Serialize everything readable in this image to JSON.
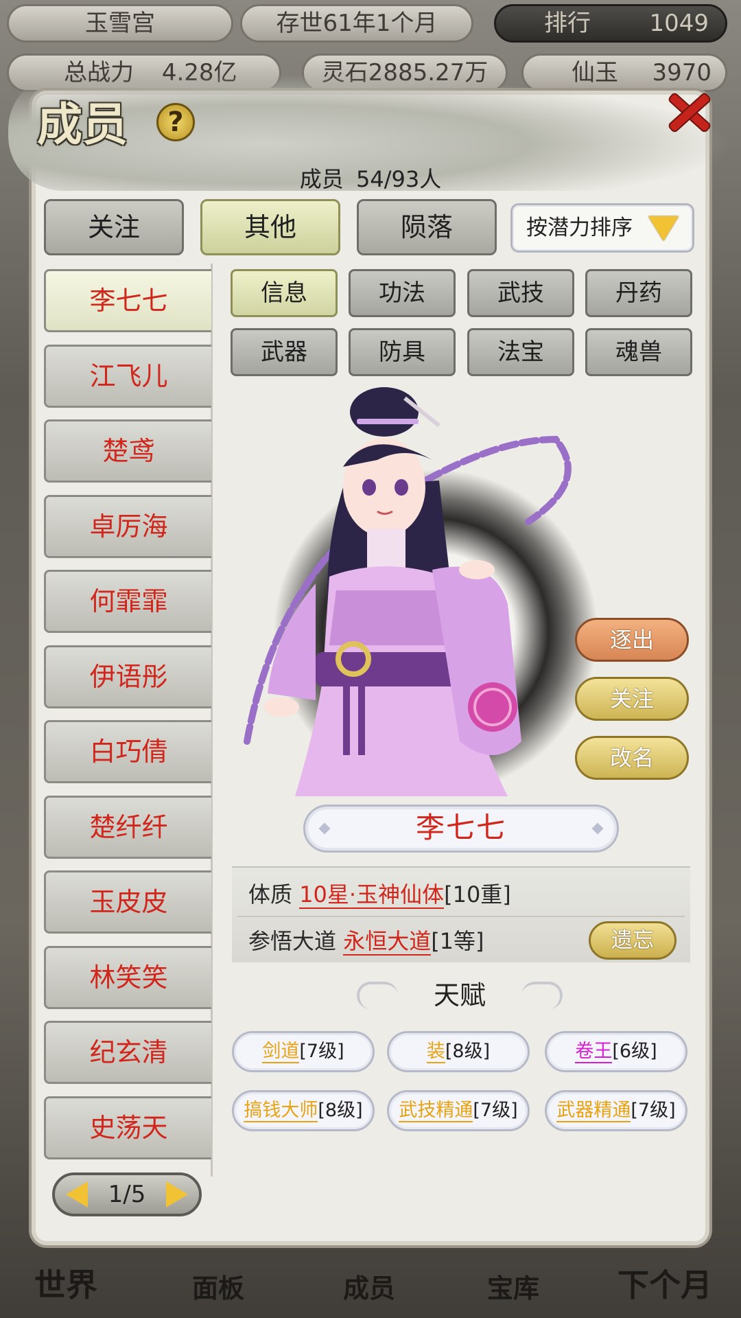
{
  "top_status": {
    "sect_name": "玉雪宫",
    "existence": "存世61年1个月",
    "rank_label": "排行",
    "rank_value": "1049",
    "power_label": "总战力",
    "power_value": "4.28亿",
    "spirit_stone": "灵石2885.27万",
    "immortal_jade_label": "仙玉",
    "immortal_jade_value": "3970"
  },
  "dialog": {
    "title": "成员",
    "help_label": "?",
    "member_count_label": "成员",
    "member_count_value": "54/93人"
  },
  "filter_tabs": [
    {
      "label": "关注",
      "active": false
    },
    {
      "label": "其他",
      "active": true
    },
    {
      "label": "陨落",
      "active": false
    }
  ],
  "sort": {
    "label": "按潜力排序"
  },
  "members": [
    {
      "name": "李七七",
      "active": true
    },
    {
      "name": "江飞儿",
      "active": false
    },
    {
      "name": "楚鸢",
      "active": false
    },
    {
      "name": "卓厉海",
      "active": false
    },
    {
      "name": "何霏霏",
      "active": false
    },
    {
      "name": "伊语彤",
      "active": false
    },
    {
      "name": "白巧倩",
      "active": false
    },
    {
      "name": "楚纤纤",
      "active": false
    },
    {
      "name": "玉皮皮",
      "active": false
    },
    {
      "name": "林笑笑",
      "active": false
    },
    {
      "name": "纪玄清",
      "active": false
    },
    {
      "name": "史荡天",
      "active": false
    }
  ],
  "pager": {
    "text": "1/5"
  },
  "detail_tabs": [
    {
      "label": "信息",
      "active": true
    },
    {
      "label": "功法",
      "active": false
    },
    {
      "label": "武技",
      "active": false
    },
    {
      "label": "丹药",
      "active": false
    },
    {
      "label": "武器",
      "active": false
    },
    {
      "label": "防具",
      "active": false
    },
    {
      "label": "法宝",
      "active": false
    },
    {
      "label": "魂兽",
      "active": false
    }
  ],
  "actions": {
    "expel": "逐出",
    "follow": "关注",
    "rename": "改名"
  },
  "selected_member": {
    "name": "李七七",
    "constitution_label": "体质",
    "constitution_value": "10星·玉神仙体",
    "constitution_level": "[10重]",
    "dao_label": "参悟大道",
    "dao_value": "永恒大道",
    "dao_level": "[1等]",
    "forget_label": "遗忘"
  },
  "talent_title": "天赋",
  "talents": [
    {
      "name": "剑道",
      "level": "[7级]",
      "color": "#e8a312"
    },
    {
      "name": "装",
      "level": "[8级]",
      "color": "#e8a312"
    },
    {
      "name": "卷王",
      "level": "[6级]",
      "color": "#d61fd0"
    },
    {
      "name": "搞钱大师",
      "level": "[8级]",
      "color": "#e8a312"
    },
    {
      "name": "武技精通",
      "level": "[7级]",
      "color": "#e8a312"
    },
    {
      "name": "武器精通",
      "level": "[7级]",
      "color": "#e8a312"
    }
  ],
  "bottom_nav": [
    "世界",
    "面板",
    "成员",
    "宝库",
    "下个月"
  ],
  "colors": {
    "name_red": "#d0261b",
    "accent_gold": "#f2c235",
    "talent_gold": "#e8a312",
    "talent_pink": "#d61fd0"
  }
}
